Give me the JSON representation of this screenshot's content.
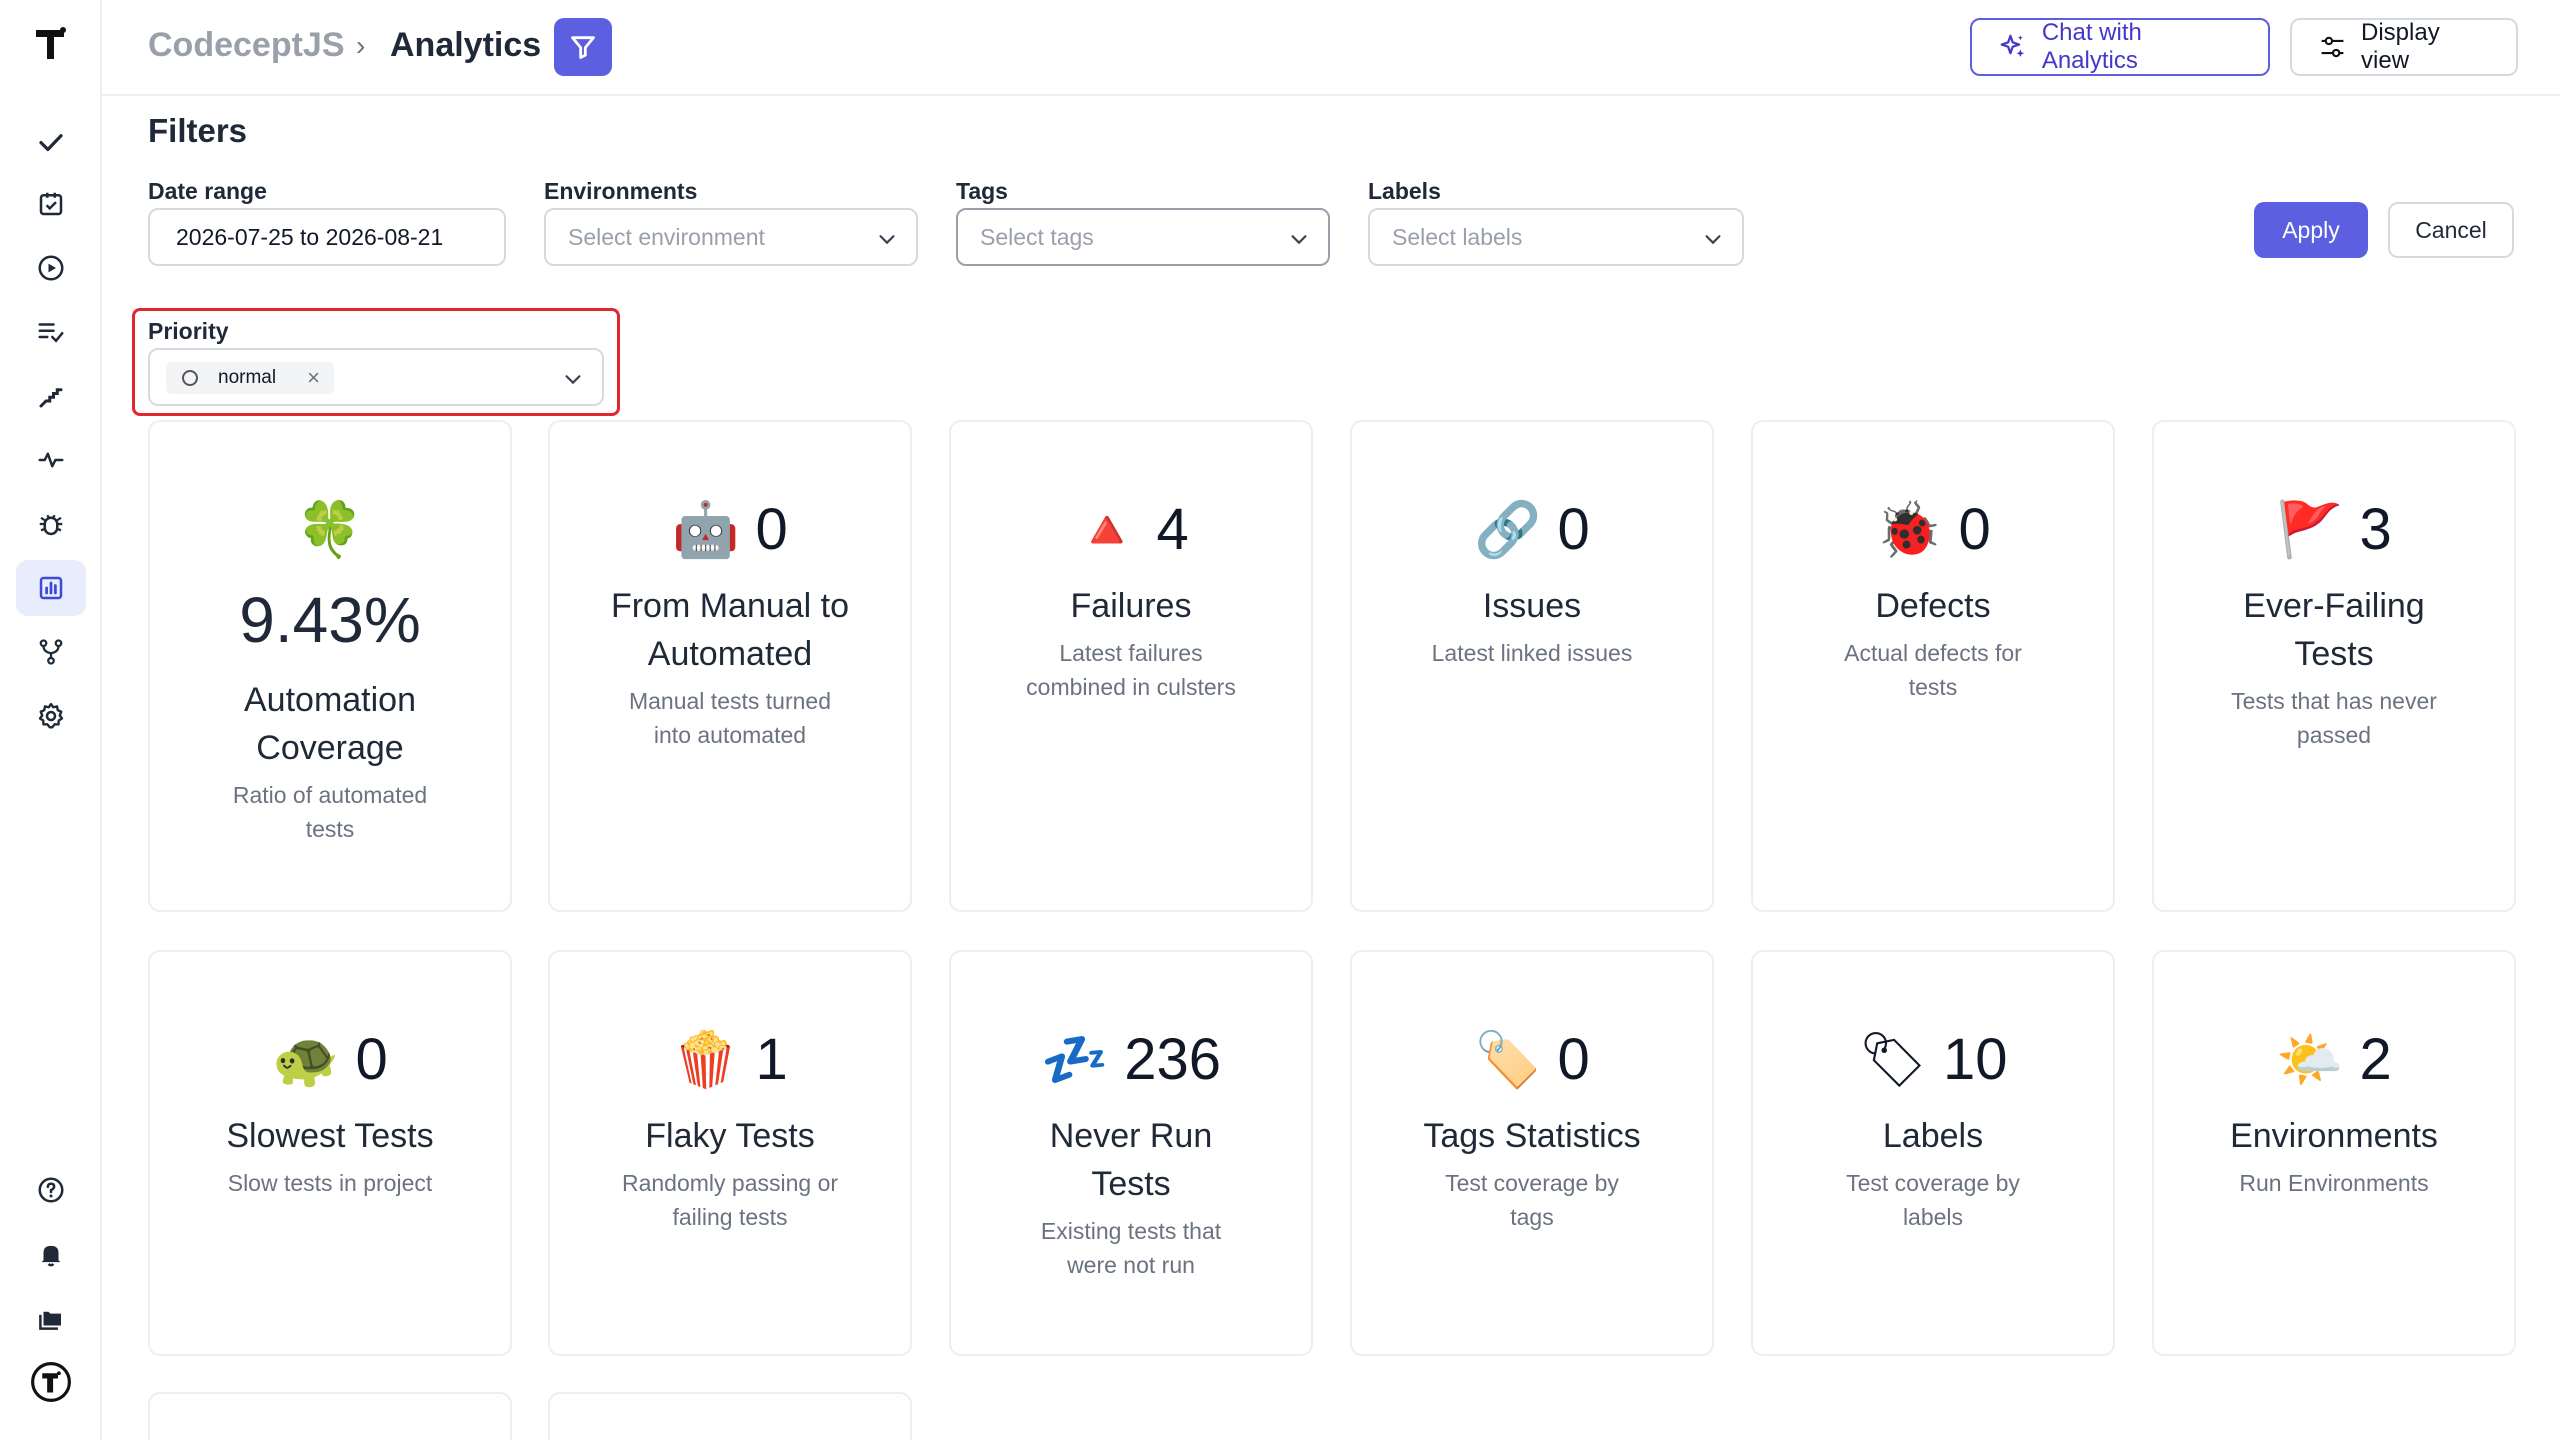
{
  "header": {
    "project": "CodeceptJS",
    "separator": "›",
    "current": "Analytics",
    "chat_label": "Chat with Analytics",
    "display_label": "Display view"
  },
  "filters": {
    "title": "Filters",
    "date_range": {
      "label": "Date range",
      "value": "2026-07-25 to 2026-08-21"
    },
    "environments": {
      "label": "Environments",
      "placeholder": "Select environment"
    },
    "tags": {
      "label": "Tags",
      "placeholder": "Select tags"
    },
    "labels": {
      "label": "Labels",
      "placeholder": "Select labels"
    },
    "priority": {
      "label": "Priority",
      "chip": "normal",
      "chip_remove": "×"
    },
    "apply": "Apply",
    "cancel": "Cancel"
  },
  "cards": [
    {
      "emoji": "🍀",
      "value": "9.43%",
      "title": "Automation Coverage",
      "desc": "Ratio of automated tests"
    },
    {
      "emoji": "🤖",
      "value": "0",
      "title": "From Manual to Automated",
      "desc": "Manual tests turned into automated"
    },
    {
      "emoji": "🔺",
      "value": "4",
      "title": "Failures",
      "desc": "Latest failures combined in culsters"
    },
    {
      "emoji": "🔗",
      "value": "0",
      "title": "Issues",
      "desc": "Latest linked issues"
    },
    {
      "emoji": "🐞",
      "value": "0",
      "title": "Defects",
      "desc": "Actual defects for tests"
    },
    {
      "emoji": "🚩",
      "value": "3",
      "title": "Ever-Failing Tests",
      "desc": "Tests that has never passed"
    },
    {
      "emoji": "🐢",
      "value": "0",
      "title": "Slowest Tests",
      "desc": "Slow tests in project"
    },
    {
      "emoji": "🍿",
      "value": "1",
      "title": "Flaky Tests",
      "desc": "Randomly passing or failing tests"
    },
    {
      "emoji": "💤",
      "value": "236",
      "title": "Never Run Tests",
      "desc": "Existing tests that were not run"
    },
    {
      "emoji": "🏷️",
      "value": "0",
      "title": "Tags Statistics",
      "desc": "Test coverage by tags"
    },
    {
      "emoji": "🏷",
      "value": "10",
      "title": "Labels",
      "desc": "Test coverage by labels"
    },
    {
      "emoji": "🌤️",
      "value": "2",
      "title": "Environments",
      "desc": "Run Environments"
    }
  ],
  "icons": {
    "nav": [
      "check-icon",
      "clipboard-check-icon",
      "play-circle-icon",
      "list-check-icon",
      "steps-icon",
      "pulse-icon",
      "bug-icon",
      "bar-chart-icon",
      "git-fork-icon",
      "gear-icon",
      "help-circle-icon",
      "bell-icon",
      "folders-icon",
      "user-avatar-icon"
    ],
    "accent": "#5b5fe0",
    "highlight": "#e0282e"
  }
}
